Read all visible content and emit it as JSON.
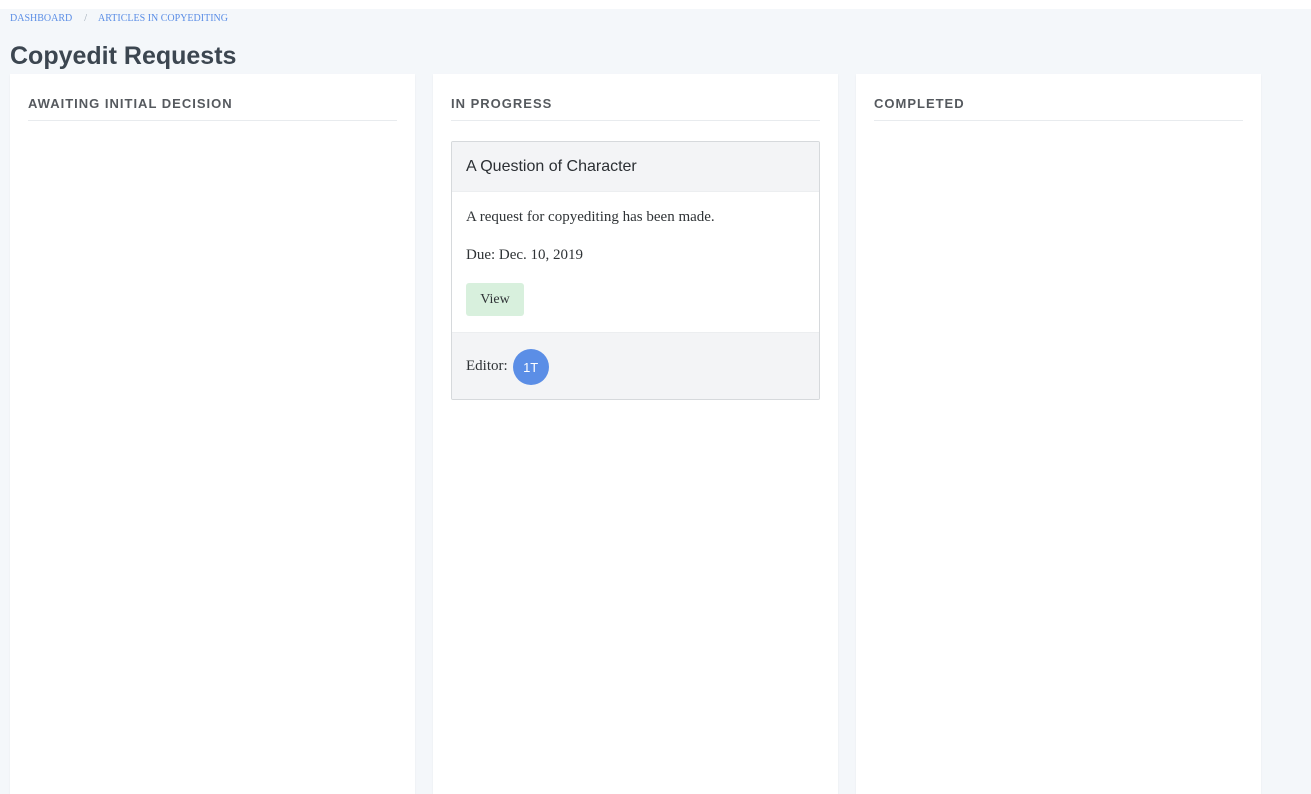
{
  "breadcrumb": {
    "items": [
      "DASHBOARD",
      "ARTICLES IN COPYEDITING"
    ],
    "separator": "/"
  },
  "page": {
    "title": "Copyedit Requests"
  },
  "columns": [
    {
      "title": "AWAITING INITIAL DECISION",
      "cards": []
    },
    {
      "title": "IN PROGRESS",
      "cards": [
        {
          "title": "A Question of Character",
          "message": "A request for copyediting has been made.",
          "due": "Due: Dec. 10, 2019",
          "view_label": "View",
          "editor_label": "Editor:",
          "editor_initials": "1T"
        }
      ]
    },
    {
      "title": "COMPLETED",
      "cards": []
    }
  ],
  "colors": {
    "accent": "#5b8ee6",
    "view_button_bg": "#d8f0dd",
    "page_bg": "#f4f7fa"
  }
}
